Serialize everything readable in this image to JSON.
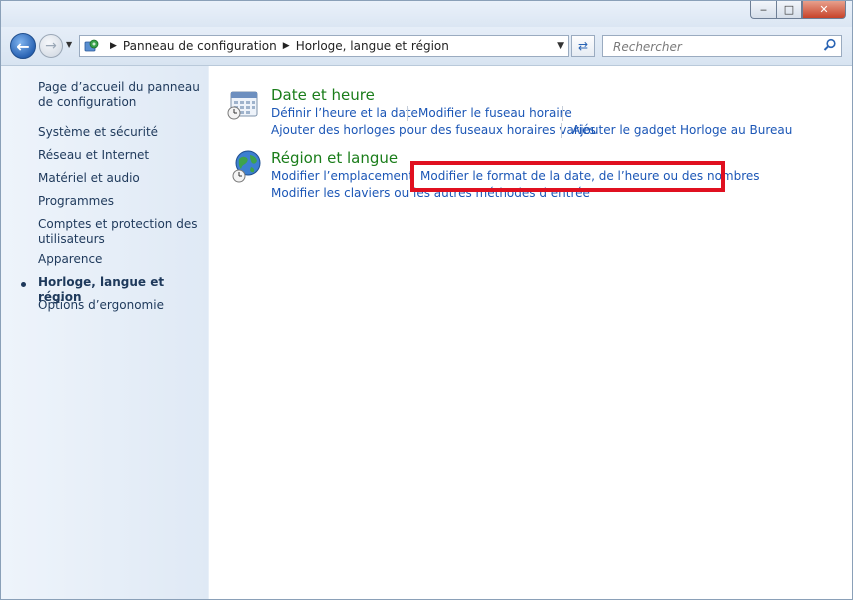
{
  "window": {
    "minimize": "‒",
    "maximize": "□",
    "close": "✕"
  },
  "nav": {
    "breadcrumb": [
      "Panneau de configuration",
      "Horloge, langue et région"
    ],
    "search_placeholder": "Rechercher"
  },
  "sidebar": {
    "items": [
      "Page d’accueil du panneau de configuration",
      "Système et sécurité",
      "Réseau et Internet",
      "Matériel et audio",
      "Programmes",
      "Comptes et protection des utilisateurs",
      "Apparence",
      "Horloge, langue et région",
      "Options d’ergonomie"
    ],
    "active_index": 7
  },
  "categories": [
    {
      "title": "Date et heure",
      "icon": "calendar-clock-icon",
      "links": [
        "Définir l’heure et la date",
        "Modifier le fuseau horaire",
        "Ajouter des horloges pour des fuseaux horaires variés",
        "Ajouter le gadget Horloge au Bureau"
      ]
    },
    {
      "title": "Région et langue",
      "icon": "globe-clock-icon",
      "links": [
        "Modifier l’emplacement",
        "Modifier le format de la date, de l’heure ou des nombres",
        "Modifier les claviers ou les autres méthodes d’entrée"
      ]
    }
  ],
  "colors": {
    "category_title": "#1a7d1a",
    "link": "#1b56b6",
    "highlight_box": "#e01020"
  }
}
